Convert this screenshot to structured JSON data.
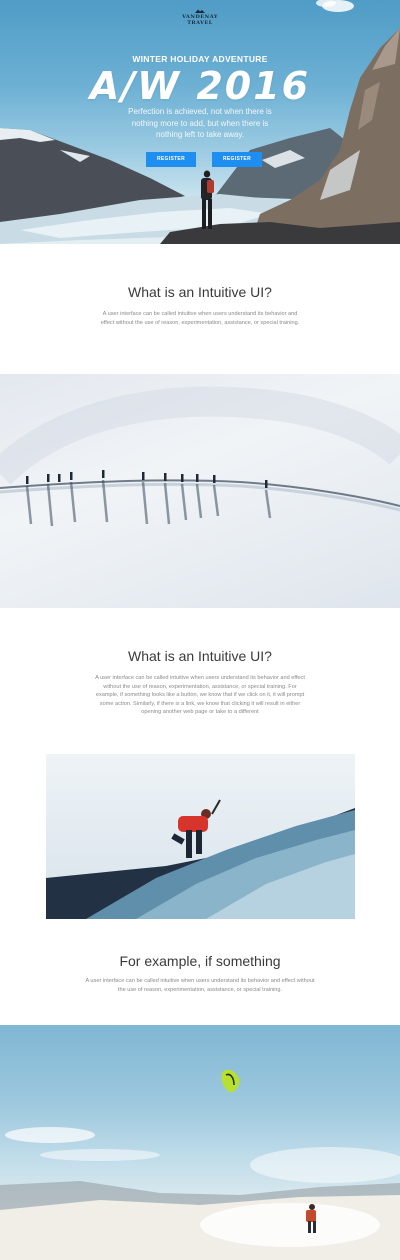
{
  "brand": {
    "line1": "VANDENAY",
    "line2": "TRAVEL"
  },
  "hero": {
    "kicker": "WINTER HOLIDAY ADVENTURE",
    "title": "A/W 2016",
    "quote": "Perfection is achieved, not when there is nothing more to add, but when there is nothing left to take away.",
    "buttons": [
      "REGISTER",
      "REGISTER"
    ]
  },
  "sections": [
    {
      "title": "What is an Intuitive UI?",
      "body": "A user interface can be called intuitive when users understand its behavior and effect without the use of reason, experimentation, assistance, or special training."
    },
    {
      "title": "What is an Intuitive UI?",
      "body": "A user interface can be called intuitive when users understand its behavior and effect without the use of reason, experimentation, assistance, or special training. For example, if something looks like a button, we know that if we click on it, it will prompt some action. Similarly, if there is a link, we know that clicking it will result in either opening another web page or take to a different"
    },
    {
      "title": "For example, if something",
      "body": "A user interface can be called intuitive when users understand its behavior and effect without the use of reason, experimentation, assistance, or special training."
    }
  ],
  "colors": {
    "button": "#1e8ff0",
    "heading": "#3a3a3a",
    "body_text": "#8a8a8a"
  }
}
